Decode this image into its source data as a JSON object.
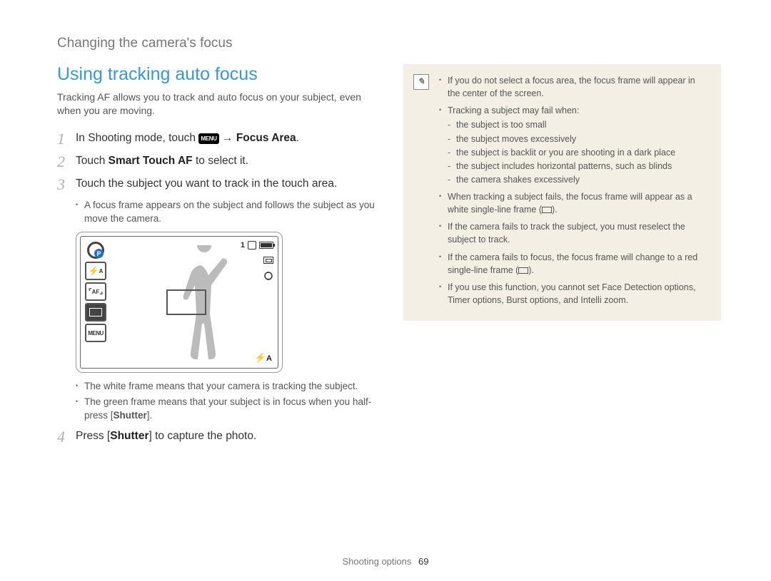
{
  "breadcrumb": "Changing the camera's focus",
  "section_title": "Using tracking auto focus",
  "intro": "Tracking AF allows you to track and auto focus on your subject, even when you are moving.",
  "steps": {
    "s1": {
      "num": "1",
      "pre": "In Shooting mode, touch ",
      "menu_chip": "MENU",
      "arrow": " → ",
      "bold": "Focus Area",
      "post": "."
    },
    "s2": {
      "num": "2",
      "pre": "Touch ",
      "bold": "Smart Touch AF",
      "post": " to select it."
    },
    "s3": {
      "num": "3",
      "text": "Touch the subject you want to track in the touch area."
    },
    "s4": {
      "num": "4",
      "pre": "Press [",
      "bold": "Shutter",
      "post": "] to capture the photo."
    }
  },
  "sub3a": "A focus frame appears on the subject and follows the subject as you move the camera.",
  "sub3b_pre": "The white frame means that your camera is tracking the subject.",
  "sub3c_pre": "The green frame means that your subject is in focus when you half-press [",
  "sub3c_bold": "Shutter",
  "sub3c_post": "].",
  "screen": {
    "count": "1",
    "mode_p": "P",
    "flash": "A",
    "af": "AF",
    "menu": "MENU",
    "flash_small": "A"
  },
  "note": {
    "b1": "If you do not select a focus area, the focus frame will appear in the center of the screen.",
    "b2": "Tracking a subject may fail when:",
    "b2_1": "the subject is too small",
    "b2_2": "the subject moves excessively",
    "b2_3": "the subject is backlit or you are shooting in a dark place",
    "b2_4": "the subject includes horizontal patterns, such as blinds",
    "b2_5": "the camera shakes excessively",
    "b3_pre": "When tracking a subject fails, the focus frame will appear as a white single-line frame (",
    "b3_post": ").",
    "b4": "If the camera fails to track the subject, you must reselect the subject to track.",
    "b5_pre": "If the camera fails to focus, the focus frame will change to a red single-line frame (",
    "b5_post": ").",
    "b6": "If you use this function, you cannot set Face Detection options, Timer options, Burst options, and Intelli zoom."
  },
  "footer": {
    "section": "Shooting options",
    "page": "69"
  }
}
